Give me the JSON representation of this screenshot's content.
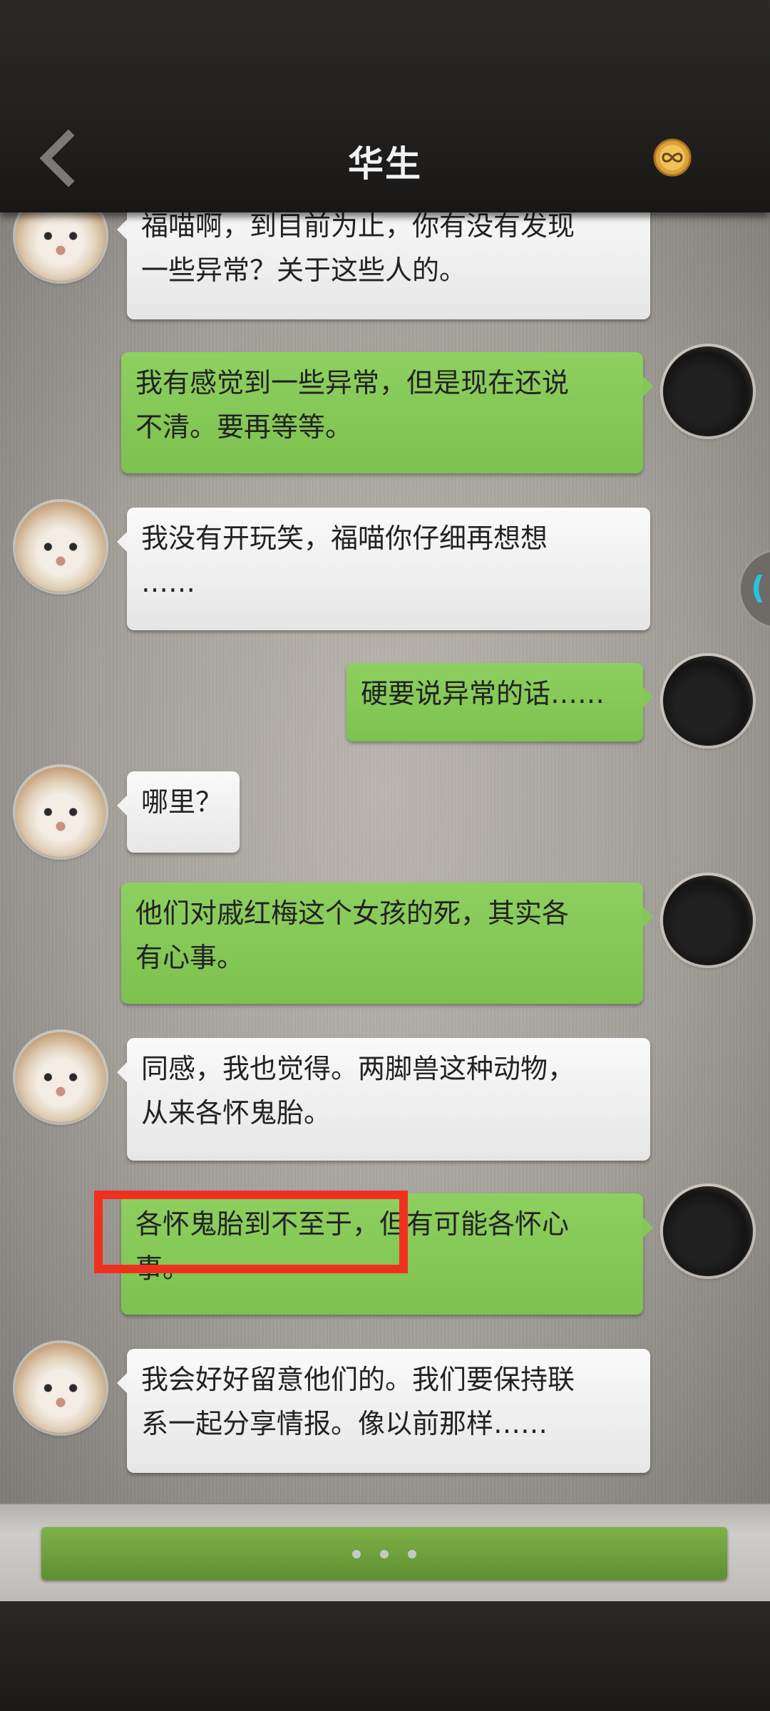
{
  "header": {
    "title": "华生",
    "back_icon": "chevron-left-icon",
    "coin_icon": "infinity-coin-icon"
  },
  "messages": [
    {
      "side": "left",
      "lines": [
        "福喵啊，到目前为止，你有没有发现",
        "一些异常？关于这些人的。"
      ]
    },
    {
      "side": "right",
      "lines": [
        "我有感觉到一些异常，但是现在还说",
        "不清。要再等等。"
      ]
    },
    {
      "side": "left",
      "lines": [
        "我没有开玩笑，福喵你仔细再想想",
        "……"
      ]
    },
    {
      "side": "right",
      "lines": [
        "硬要说异常的话……"
      ]
    },
    {
      "side": "left",
      "lines": [
        "哪里？"
      ]
    },
    {
      "side": "right",
      "lines": [
        "他们对戚红梅这个女孩的死，其实各",
        "有心事。"
      ]
    },
    {
      "side": "left",
      "lines": [
        "同感，我也觉得。两脚兽这种动物，",
        "从来各怀鬼胎。"
      ]
    },
    {
      "side": "right",
      "lines": [
        "各怀鬼胎到不至于，但有可能各怀心",
        "事。"
      ]
    },
    {
      "side": "left",
      "lines": [
        "我会好好留意他们的。我们要保持联",
        "系一起分享情报。像以前那样……"
      ]
    }
  ],
  "side_tab": {
    "glyph": "("
  },
  "colors": {
    "right_bubble": "#86c858",
    "left_bubble": "#f2f2f2",
    "highlight": "#f0301f",
    "input_bar": "#6fa03b"
  }
}
